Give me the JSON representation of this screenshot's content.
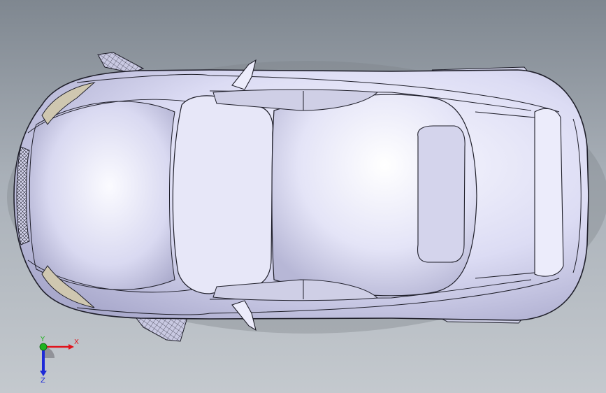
{
  "viewport": {
    "background_top": "#7f8790",
    "background_bottom": "#c4c9ce"
  },
  "model": {
    "body_color": "#dcdcf4",
    "highlight_color": "#f7f7ff",
    "shadow_color": "#a9a9cc",
    "edge_color": "#1f1f2a",
    "glass_tint": "#e8e8f8"
  },
  "triad": {
    "x_label": "X",
    "y_label": "Y",
    "z_label": "Z",
    "x_color": "#e0141c",
    "y_color": "#1fb31f",
    "z_color": "#1e2ad8"
  }
}
